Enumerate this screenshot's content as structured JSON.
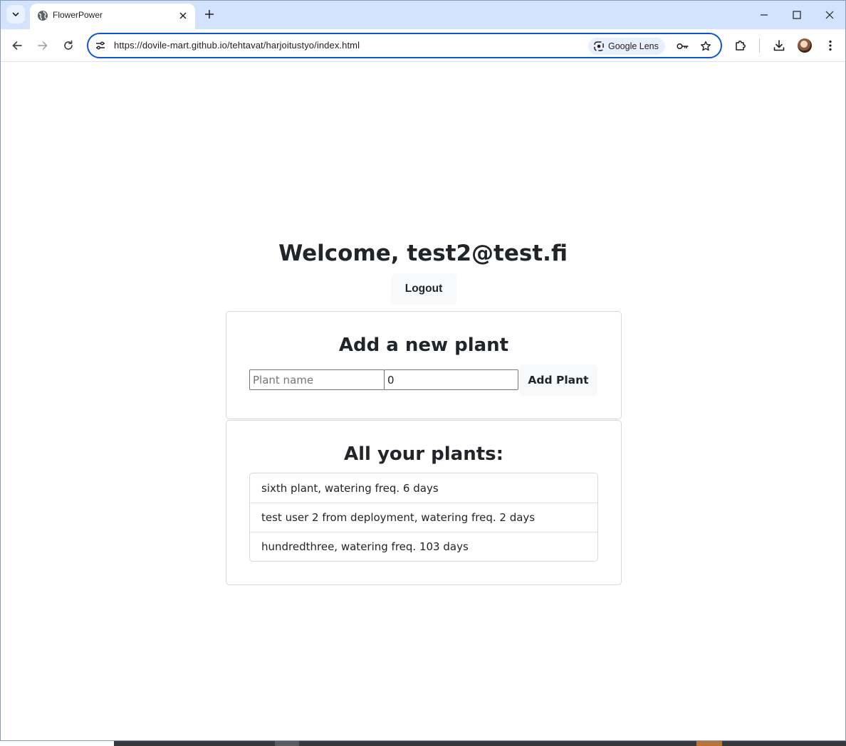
{
  "browser": {
    "tab_title": "FlowerPower",
    "url": "https://dovile-mart.github.io/tehtavat/harjoitustyo/index.html",
    "lens_label": "Google Lens"
  },
  "page": {
    "welcome": "Welcome, test2@test.fi",
    "logout_label": "Logout",
    "add_card": {
      "title": "Add a new plant",
      "name_placeholder": "Plant name",
      "freq_value": "0",
      "add_label": "Add Plant"
    },
    "list_card": {
      "title": "All your plants:",
      "plants": [
        "sixth plant, watering freq. 6 days",
        "test user 2 from deployment, watering freq. 2 days",
        "hundredthree, watering freq. 103 days"
      ]
    }
  },
  "colors": {
    "tabstrip": "#d3e3fd",
    "omnibox_border": "#0b57d0",
    "button_bg": "#f8f9fa",
    "text": "#212529"
  }
}
